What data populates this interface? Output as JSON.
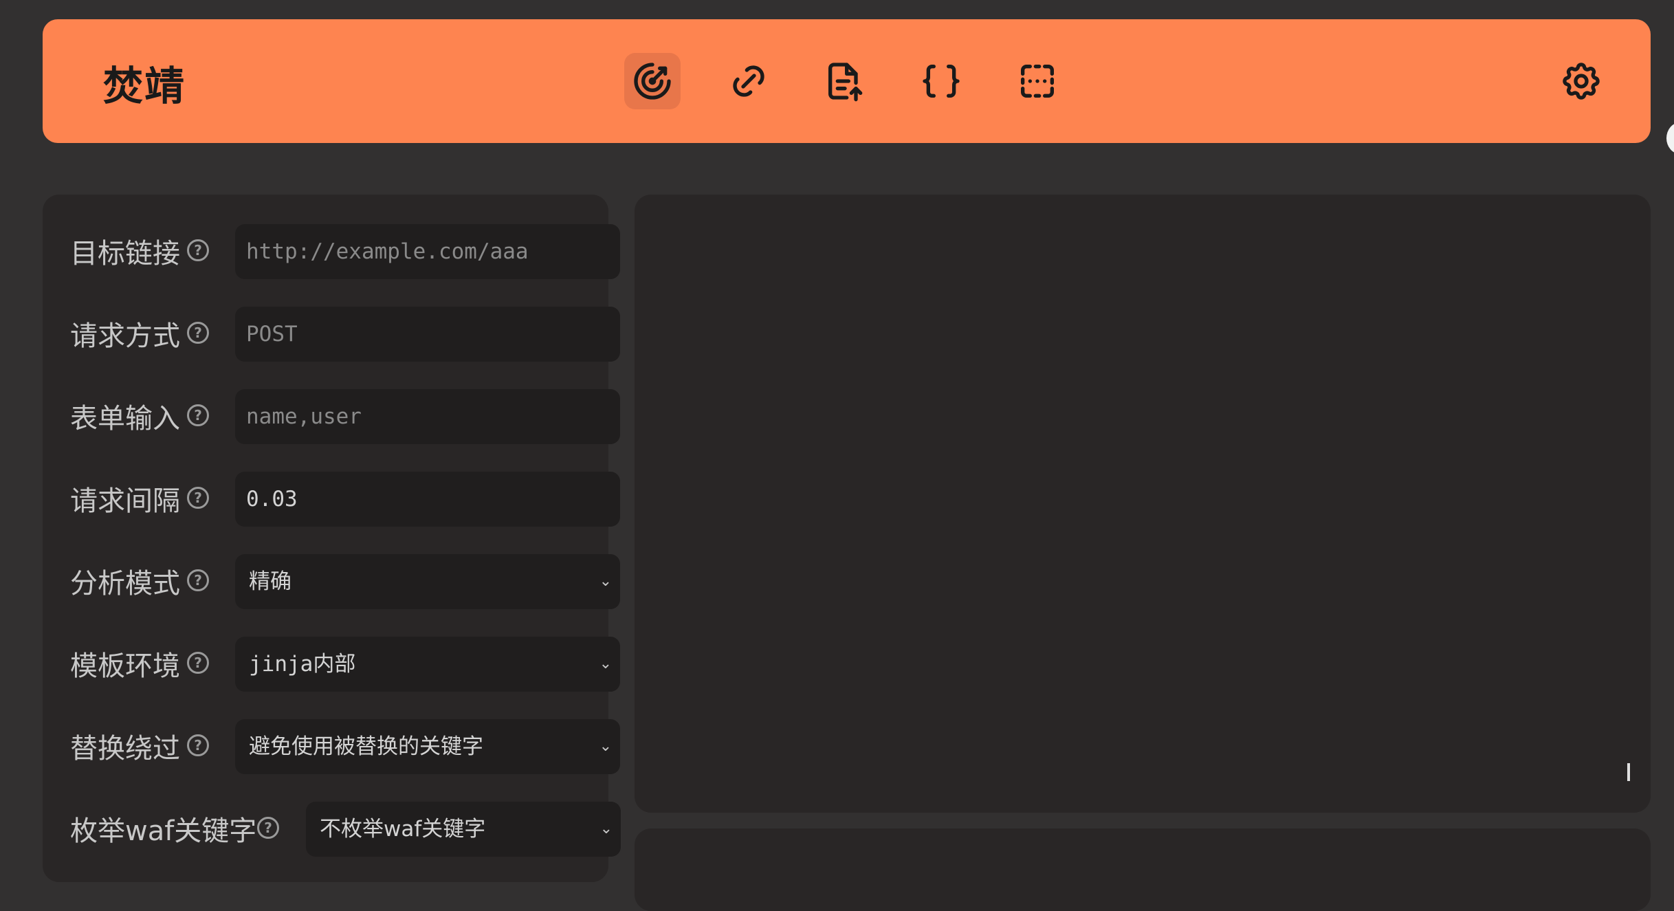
{
  "app": {
    "brand": "焚靖"
  },
  "nav": {
    "items": [
      {
        "name": "crack-target",
        "icon": "target-icon",
        "active": true
      },
      {
        "name": "crack-path",
        "icon": "link-icon",
        "active": false
      },
      {
        "name": "crack-form",
        "icon": "file-upload-icon",
        "active": false
      },
      {
        "name": "crack-json",
        "icon": "braces-icon",
        "active": false
      },
      {
        "name": "scan",
        "icon": "scan-frame-icon",
        "active": false
      }
    ],
    "settings_icon": "gear-icon"
  },
  "form": {
    "target_url": {
      "label": "目标链接",
      "placeholder": "http://example.com/aaa",
      "value": ""
    },
    "method": {
      "label": "请求方式",
      "placeholder": "POST",
      "value": ""
    },
    "inputs": {
      "label": "表单输入",
      "placeholder": "name,user",
      "value": ""
    },
    "interval": {
      "label": "请求间隔",
      "placeholder": "",
      "value": "0.03"
    },
    "detect_mode": {
      "label": "分析模式",
      "value": "精确"
    },
    "environment": {
      "label": "模板环境",
      "value": "jinja内部"
    },
    "replaced_keyword_strategy": {
      "label": "替换绕过",
      "value": "避免使用被替换的关键字"
    },
    "waf_keyword_enum": {
      "label": "枚举waf关键字",
      "value": "不枚举waf关键字"
    },
    "help_glyph": "?"
  },
  "colors": {
    "accent": "#fe8450",
    "background": "#323030",
    "panel": "#292626",
    "field": "#201e1e"
  }
}
